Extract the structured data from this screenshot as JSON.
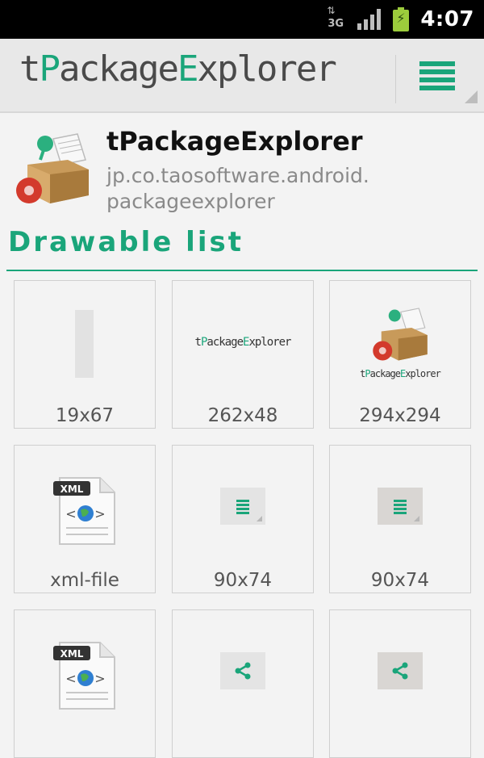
{
  "status_bar": {
    "network_type": "3G",
    "icons": [
      "network-3g-icon",
      "signal-icon",
      "battery-charging-icon"
    ],
    "time": "4:07"
  },
  "action_bar": {
    "logo": {
      "p1": "t",
      "p2": "P",
      "p3": "ackage",
      "p4": "E",
      "p5": "xplorer"
    },
    "menu_icon": "hamburger-menu-icon"
  },
  "app": {
    "icon": "package-explorer-box-icon",
    "name": "tPackageExplorer",
    "package_line1": "jp.co.taosoftware.android.",
    "package_line2": "packageexplorer"
  },
  "section": {
    "title": "Drawable list"
  },
  "drawables": [
    {
      "label": "19x67",
      "preview": "gray-bar"
    },
    {
      "label": "262x48",
      "preview": "tpackageexplorer-wordmark"
    },
    {
      "label": "294x294",
      "preview": "app-icon-with-wordmark"
    },
    {
      "label": "xml-file",
      "preview": "xml-file-icon"
    },
    {
      "label": "90x74",
      "preview": "menu-button"
    },
    {
      "label": "90x74",
      "preview": "menu-button-pressed"
    },
    {
      "label": "",
      "preview": "xml-file-icon"
    },
    {
      "label": "",
      "preview": "share-button"
    },
    {
      "label": "",
      "preview": "share-button-pressed"
    }
  ],
  "colors": {
    "accent": "#1aa57a",
    "status_bar": "#000000",
    "action_bar": "#e8e8e8",
    "background": "#f3f3f3"
  }
}
